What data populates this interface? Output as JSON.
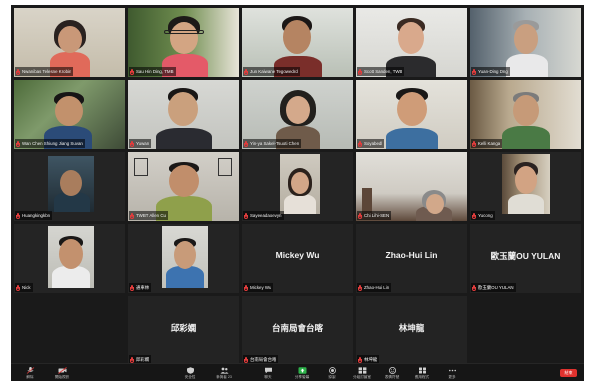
{
  "participants": [
    {
      "name": "Nwanibas Telesne Krobin"
    },
    {
      "name": "Sau Hin Ding, TMB"
    },
    {
      "name": "Jun Kaiwane Tegowedrd"
    },
    {
      "name": "Scott Sanden, TWB"
    },
    {
      "name": "Yuan-Ding Dng"
    },
    {
      "name": "Wan Chen Shiung Jiang Suvan"
    },
    {
      "name": "Yuwan"
    },
    {
      "name": "Yin-ya Sakel-Tsuoti Chen"
    },
    {
      "name": "Soyabedl"
    },
    {
      "name": "Kelli Kanga"
    },
    {
      "name": "Huangkingkbn"
    },
    {
      "name": "TWBT Allen Cu"
    },
    {
      "name": "Sayeeadaoevyn"
    },
    {
      "name": "Chi Lihi-SEN"
    },
    {
      "name": "Yucong"
    },
    {
      "name": "Nick"
    },
    {
      "name": "通車林"
    },
    {
      "name": "Mickey Wu",
      "display": "Mickey Wu"
    },
    {
      "name": "Zhao-Hui Lin",
      "display": "Zhao-Hui Lin"
    },
    {
      "name": "歐玉蘭OU YULAN",
      "display": "歐玉蘭OU  YULAN"
    },
    {
      "name": "邱彩嫻",
      "display": "邱彩嫻"
    },
    {
      "name": "台南局會台喀",
      "display": "台南局會台喀"
    },
    {
      "name": "林坤龍",
      "display": "林坤龍"
    }
  ],
  "toolbar": {
    "unmute": "解除",
    "video": "開始視訊",
    "security": "安全性",
    "participants": "參與者",
    "participants_count": "23",
    "chat": "聊天",
    "share": "分享螢幕",
    "record": "錄製",
    "breakout": "分組討論室",
    "reactions": "表情符號",
    "apps": "應用程式",
    "more": "更多",
    "end": "結束"
  },
  "colors": {
    "frame_bg": "#1a1a1a",
    "tile_bg": "#232323",
    "active_speaker": "#d7e26a",
    "muted_icon": "#e23c3c",
    "share_button": "#2db34a",
    "end_button": "#e0322e"
  }
}
